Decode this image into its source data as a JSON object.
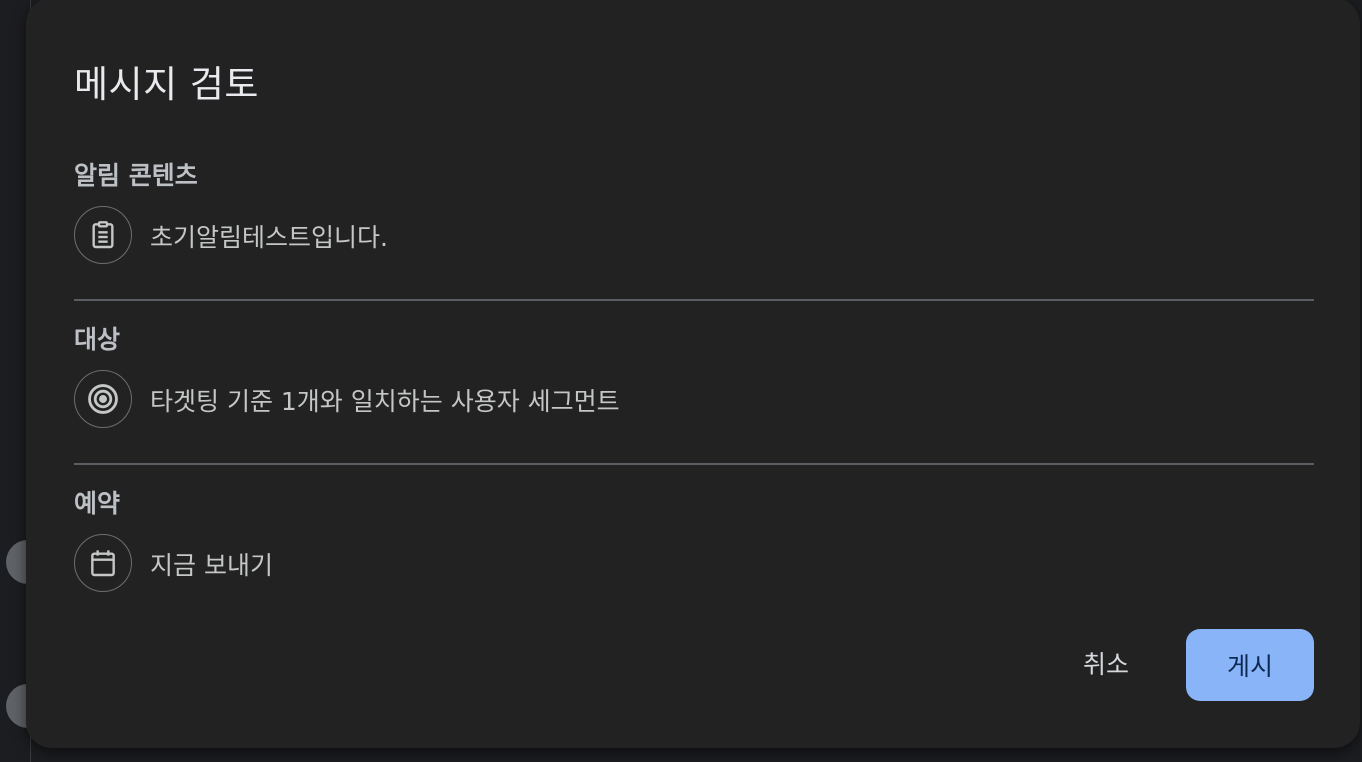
{
  "dialog": {
    "title": "메시지 검토",
    "sections": [
      {
        "label": "알림 콘텐츠",
        "icon": "clipboard-icon",
        "text": "초기알림테스트입니다."
      },
      {
        "label": "대상",
        "icon": "target-icon",
        "text": "타겟팅 기준 1개와 일치하는 사용자 세그먼트"
      },
      {
        "label": "예약",
        "icon": "calendar-icon",
        "text": "지금 보내기"
      }
    ],
    "cancel_label": "취소",
    "post_label": "게시"
  },
  "colors": {
    "dialog_bg": "#222222",
    "primary_button": "#8ab4f8",
    "divider": "#5a5d61"
  }
}
